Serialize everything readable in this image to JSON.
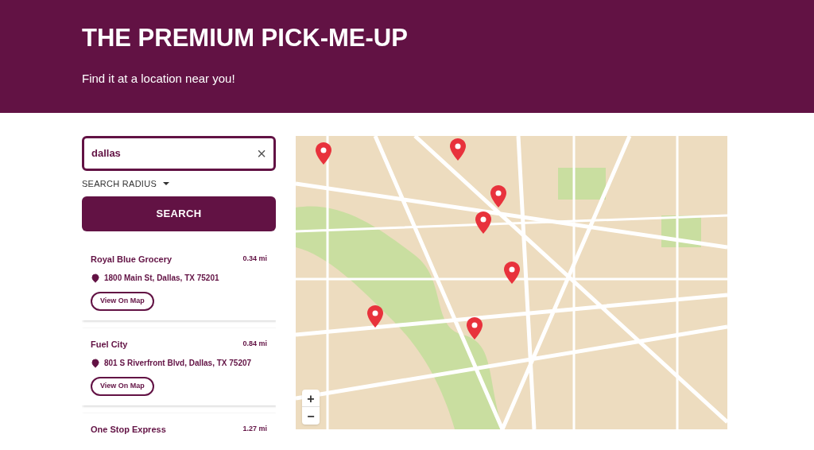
{
  "header": {
    "title": "THE PREMIUM PICK-ME-UP",
    "subtitle": "Find it at a location near you!"
  },
  "search": {
    "value": "dallas",
    "clear": "×",
    "radius_label": "SEARCH RADIUS",
    "button": "SEARCH"
  },
  "locations": [
    {
      "name": "Royal Blue Grocery",
      "distance": "0.34 mi",
      "address": "1800 Main St, Dallas, TX 75201",
      "action": "View On Map"
    },
    {
      "name": "Fuel City",
      "distance": "0.84 mi",
      "address": "801 S Riverfront Blvd, Dallas, TX 75207",
      "action": "View On Map"
    },
    {
      "name": "One Stop Express",
      "distance": "1.27 mi"
    }
  ],
  "map": {
    "zoom_in": "+",
    "zoom_out": "−"
  }
}
